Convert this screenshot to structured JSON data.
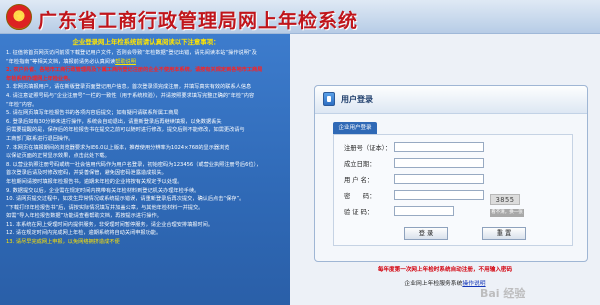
{
  "header": {
    "title": "广东省工商行政管理局网上年检系统"
  },
  "notice": {
    "heading": "企业登录网上年检系统前请认真阅读以下注意事项：",
    "lines": [
      {
        "text": "1. 征值将首页网页访问前须下载登记用户文件，否则会导致“年检数据”登记出错，请先阅读本站“操作说明”及",
        "style": "white"
      },
      {
        "text": "   “年检指南”等相关文档，填报前请务必认真阅读",
        "style": "white",
        "link": "帮助说明"
      },
      {
        "text": "2. 农户外省、各地市工商行政管理局及下属工商所登记注册的企业不使用本系统，请按有关规定到各地市工商局",
        "style": "red"
      },
      {
        "text": "   年检系统办理网上年检业务。",
        "style": "red"
      },
      {
        "text": "3. 非网页填报用户，请在新版登录页面登记用户信息，首次登录须完成注册，并填写真实有效的联系人信息",
        "style": "white"
      },
      {
        "text": "4. 请注意证照号码与“企业注册号”一栏的一致性（用于系统校验），并请按照要求填写完整正确的“年检”内容",
        "style": "white"
      },
      {
        "text": "   “年检”内容。",
        "style": "white"
      },
      {
        "text": "5. 请在网页填写年检报告书的各项内容后提交；如有疑问请联系所属工商局",
        "style": "white"
      },
      {
        "text": "6. 登录后如有30分钟未进行操作，系统会自动退出，请重新登录后再继续填报，以免数据丢失",
        "style": "white"
      },
      {
        "text": "   另需要提醒的是，保存后的年检报告书在提交之前可以随时进行修改，提交后则不能修改，如需更改请与",
        "style": "white"
      },
      {
        "text": "   工商部门联系进行退回操作。",
        "style": "white"
      },
      {
        "text": "7. 本网页在填报期间的浏览器要求为IE6.0以上版本，推荐使用分辨率为1024×768的显示器浏览",
        "style": "white"
      },
      {
        "text": "   以保证页面的正常显示效果，点击此处下载。",
        "style": "white"
      },
      {
        "text": "8. 以营业执照注册号码或统一社会信用代码作为用户名登录，初始密码为123456（或营业执照注册号后6位），",
        "style": "white"
      },
      {
        "text": "   首次登录后请及时修改密码，并妥善保管，避免因密码泄露造成损失。",
        "style": "white"
      },
      {
        "text": "   年检期间请按时填报年检报告书，逾期未年检的企业将按有关规定予以处理。",
        "style": "white"
      },
      {
        "text": "9. 数据提交以后，企业需在规定时间内携带有关年检材料到登记机关办理年检手续。",
        "style": "white"
      },
      {
        "text": "10. 请网页提交过程中，如发生异常情况或系统提示错误，请重新登录后再次提交，确认后点击“保存”。",
        "style": "white"
      },
      {
        "text": "    “下载打印年检报告书”后，请按实际情况填写并加盖公章，与其他年检材料一并提交。",
        "style": "white"
      },
      {
        "text": "    如需“导入年检报告数据”功能请查看帮助文档，再按提示进行操作。",
        "style": "white"
      },
      {
        "text": "11. 本系统在网上受理时间内提供服务，非受理时间暂停服务，请企业合理安排填报时间。",
        "style": "white"
      },
      {
        "text": "12. 请在规定时间内完成网上年检，逾期系统将自动关闭申报功能。",
        "style": "white"
      },
      {
        "text": "13. 请尽早完成网上申报，以免网络拥挤造成不便",
        "style": "yellow"
      }
    ]
  },
  "login": {
    "title": "用户登录",
    "tab": "企业用户登录",
    "fields": {
      "reg_no": "注册号（证本）：",
      "est_date": "成立日期：",
      "user": "用 户 名：",
      "password": "密　　码：",
      "captcha": "验 证 码："
    },
    "captcha_value": "3855",
    "captcha_hint": "看不清，换一张",
    "buttons": {
      "login": "登 录",
      "reset": "重 置"
    },
    "warning": "每年度第一次网上年检时系统自动注册，不用输入密码",
    "manual_prefix": "企业网上年检服务系统",
    "manual_link": "操作说明"
  },
  "watermark": "Bai 经验"
}
